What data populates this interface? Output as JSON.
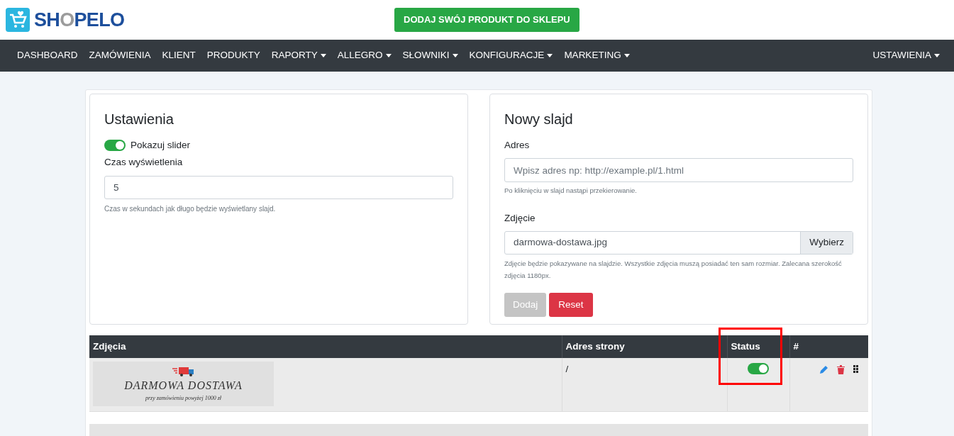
{
  "brand": {
    "name_start": "SH",
    "name_middle": "O",
    "name_end": "PELO"
  },
  "cta_button": "DODAJ SWÓJ PRODUKT DO SKLEPU",
  "nav": [
    {
      "label": "DASHBOARD",
      "dropdown": false
    },
    {
      "label": "ZAMÓWIENIA",
      "dropdown": false
    },
    {
      "label": "KLIENT",
      "dropdown": false
    },
    {
      "label": "PRODUKTY",
      "dropdown": false
    },
    {
      "label": "RAPORTY",
      "dropdown": true
    },
    {
      "label": "ALLEGRO",
      "dropdown": true
    },
    {
      "label": "SŁOWNIKI",
      "dropdown": true
    },
    {
      "label": "KONFIGURACJE",
      "dropdown": true
    },
    {
      "label": "MARKETING",
      "dropdown": true
    }
  ],
  "nav_right": {
    "label": "USTAWIENIA",
    "dropdown": true
  },
  "settings": {
    "title": "Ustawienia",
    "toggle_label": "Pokazuj slider",
    "toggle_on": true,
    "duration_label": "Czas wyświetlenia",
    "duration_value": "5",
    "duration_help": "Czas w sekundach jak długo będzie wyświetlany slajd."
  },
  "new_slide": {
    "title": "Nowy slajd",
    "address_label": "Adres",
    "address_placeholder": "Wpisz adres np: http://example.pl/1.html",
    "address_help": "Po kliknięciu w slajd nastąpi przekierowanie.",
    "image_label": "Zdjęcie",
    "image_value": "darmowa-dostawa.jpg",
    "browse_button": "Wybierz",
    "image_help": "Zdjęcie będzie pokazywane na slajdzie. Wszystkie zdjęcia muszą posiadać ten sam rozmiar. Zalecana szerokość zdjęcia 1180px.",
    "add_button": {
      "label": "Dodaj",
      "disabled": true
    },
    "reset_button": "Reset"
  },
  "table": {
    "columns": [
      "Zdjęcia",
      "Adres strony",
      "Status",
      "#"
    ],
    "rows": [
      {
        "banner_title": "DARMOWA DOSTAWA",
        "banner_subtitle": "przy zamówieniu powyżej 1000 zł",
        "address": "/",
        "status_on": true
      }
    ]
  },
  "status_column_highlighted": true
}
